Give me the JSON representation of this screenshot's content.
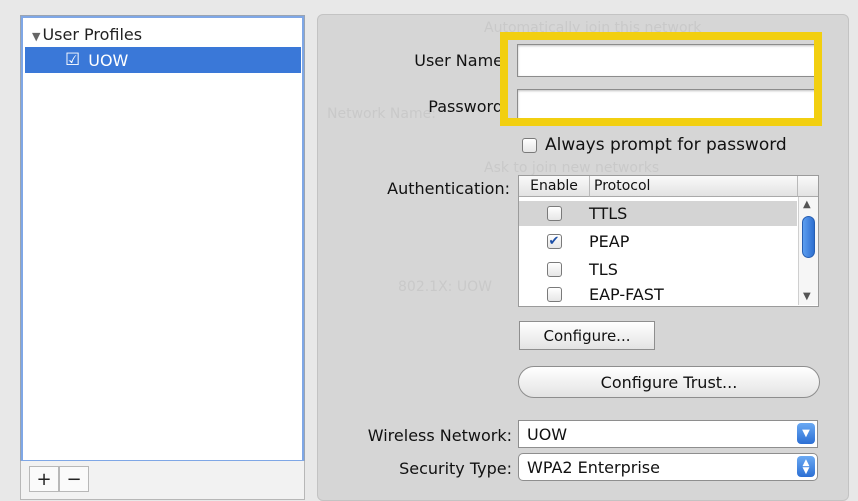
{
  "sidebar": {
    "root_label": "User Profiles",
    "root_toggle": "▼",
    "items": [
      {
        "label": "UOW",
        "checked": true
      }
    ],
    "add_label": "+",
    "remove_label": "−"
  },
  "background_ghost": {
    "line1": "Automatically join this network",
    "line2": "Network Name:",
    "line3": "Ask to join new networks",
    "line4": "802.1X: UOW"
  },
  "form": {
    "username_label": "User Name",
    "username_value": "",
    "password_label": "Password",
    "password_value": "",
    "always_prompt_label": "Always prompt for password",
    "always_prompt_checked": false,
    "auth_label": "Authentication:",
    "auth_columns": [
      "Enable",
      "Protocol"
    ],
    "auth_rows": [
      {
        "protocol": "TTLS",
        "enabled": false,
        "selected": true
      },
      {
        "protocol": "PEAP",
        "enabled": true,
        "selected": false
      },
      {
        "protocol": "TLS",
        "enabled": false,
        "selected": false
      },
      {
        "protocol": "EAP-FAST",
        "enabled": false,
        "selected": false
      }
    ],
    "configure_label": "Configure...",
    "configure_trust_label": "Configure Trust...",
    "wireless_label": "Wireless Network:",
    "wireless_value": "UOW",
    "security_label": "Security Type:",
    "security_value": "WPA2 Enterprise"
  },
  "colors": {
    "highlight": "#f2cf10",
    "selection": "#3a78d8",
    "accent": "#2c6fd4"
  }
}
